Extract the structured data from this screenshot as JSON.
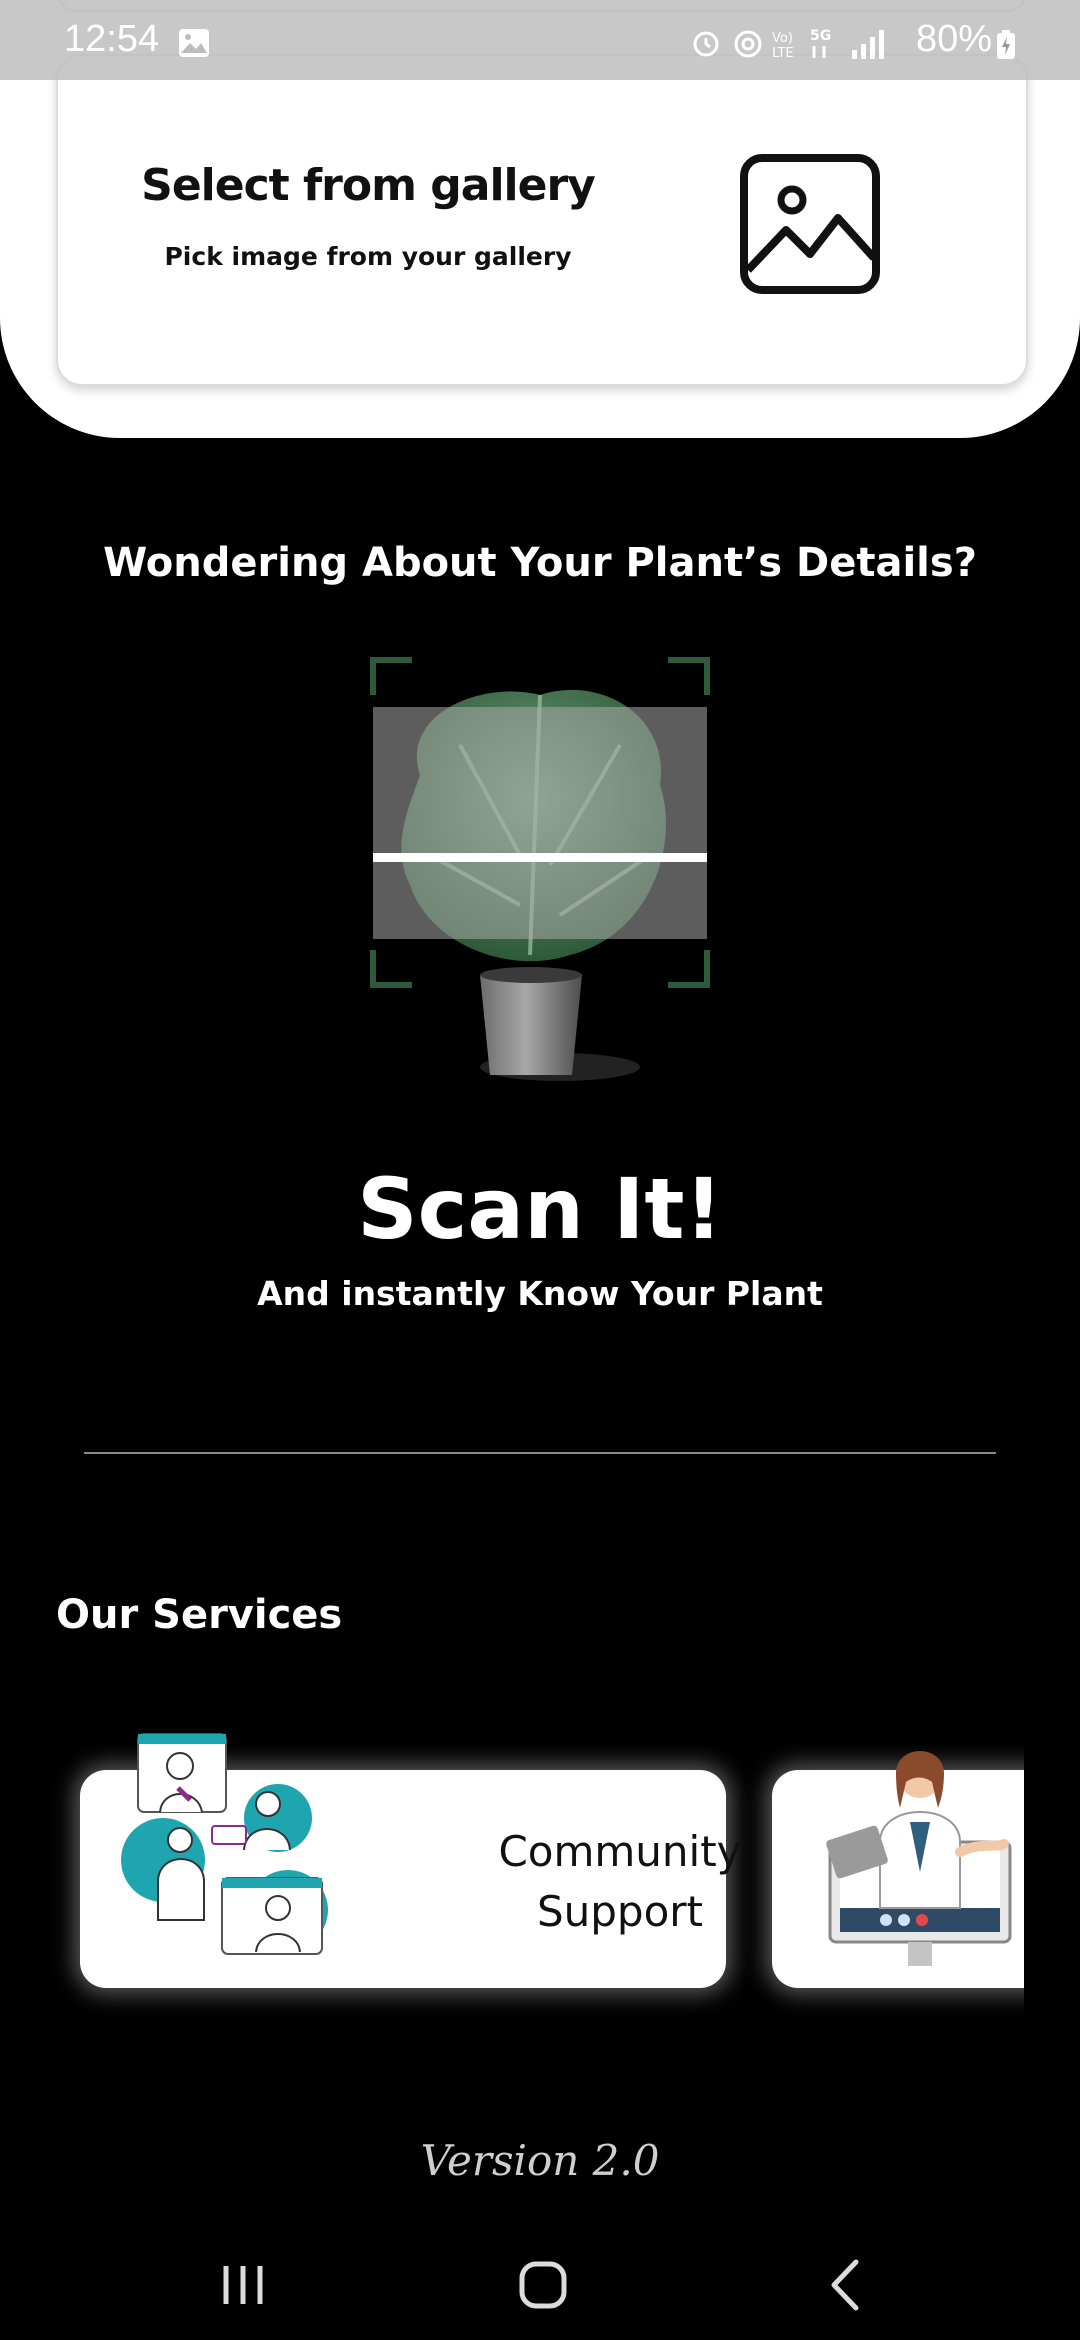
{
  "status_bar": {
    "time": "12:54",
    "battery_percent": "80%"
  },
  "gallery_card": {
    "title": "Select from gallery",
    "subtitle": "Pick image from your gallery",
    "icon": "image-icon"
  },
  "main": {
    "question": "Wondering About Your Plant’s Details?",
    "scan_title": "Scan It!",
    "scan_subtitle": "And instantly Know Your Plant"
  },
  "services": {
    "title": "Our Services",
    "cards": [
      {
        "label_line1": "Community",
        "label_line2": "Support",
        "icon": "community-illustration"
      },
      {
        "label_line1": "",
        "label_line2": "",
        "icon": "doctor-illustration"
      }
    ]
  },
  "footer": {
    "version": "Version 2.0"
  },
  "nav_bar": {
    "buttons": [
      "recent-apps-icon",
      "home-icon",
      "back-icon"
    ]
  },
  "colors": {
    "background": "#000000",
    "card": "#ffffff",
    "scanner_frame": "#2f5a3a",
    "accent_teal": "#1fa5b0"
  }
}
